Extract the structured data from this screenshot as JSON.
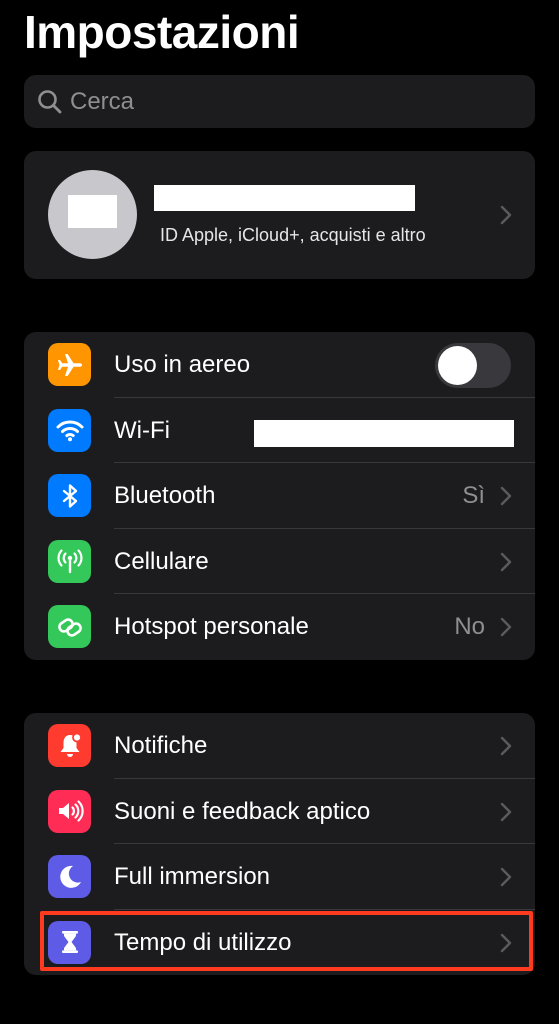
{
  "header": {
    "title": "Impostazioni"
  },
  "search": {
    "placeholder": "Cerca"
  },
  "profile": {
    "subtitle": "ID Apple, iCloud+, acquisti e altro"
  },
  "network": {
    "airplane": {
      "label": "Uso in aereo",
      "toggle_on": false
    },
    "wifi": {
      "label": "Wi-Fi"
    },
    "bluetooth": {
      "label": "Bluetooth",
      "value": "Sì"
    },
    "cellular": {
      "label": "Cellulare"
    },
    "hotspot": {
      "label": "Hotspot personale",
      "value": "No"
    }
  },
  "system": {
    "notifications": {
      "label": "Notifiche"
    },
    "sounds": {
      "label": "Suoni e feedback aptico"
    },
    "focus": {
      "label": "Full immersion"
    },
    "screentime": {
      "label": "Tempo di utilizzo"
    }
  },
  "icons": {
    "airplane": "airplane-icon",
    "wifi": "wifi-icon",
    "bluetooth": "bluetooth-icon",
    "cellular": "antenna-icon",
    "hotspot": "link-icon",
    "notifications": "bell-icon",
    "sounds": "speaker-icon",
    "focus": "moon-icon",
    "screentime": "hourglass-icon"
  },
  "colors": {
    "background": "#000000",
    "cell": "#1c1c1e",
    "airplane": "#ff9500",
    "wifi": "#007aff",
    "bluetooth": "#007aff",
    "cellular": "#34c759",
    "hotspot": "#34c759",
    "notifications": "#ff3b30",
    "sounds": "#ff2d55",
    "focus": "#5e5ce6",
    "screentime": "#5e5ce6",
    "highlight": "#ff3b1f"
  }
}
